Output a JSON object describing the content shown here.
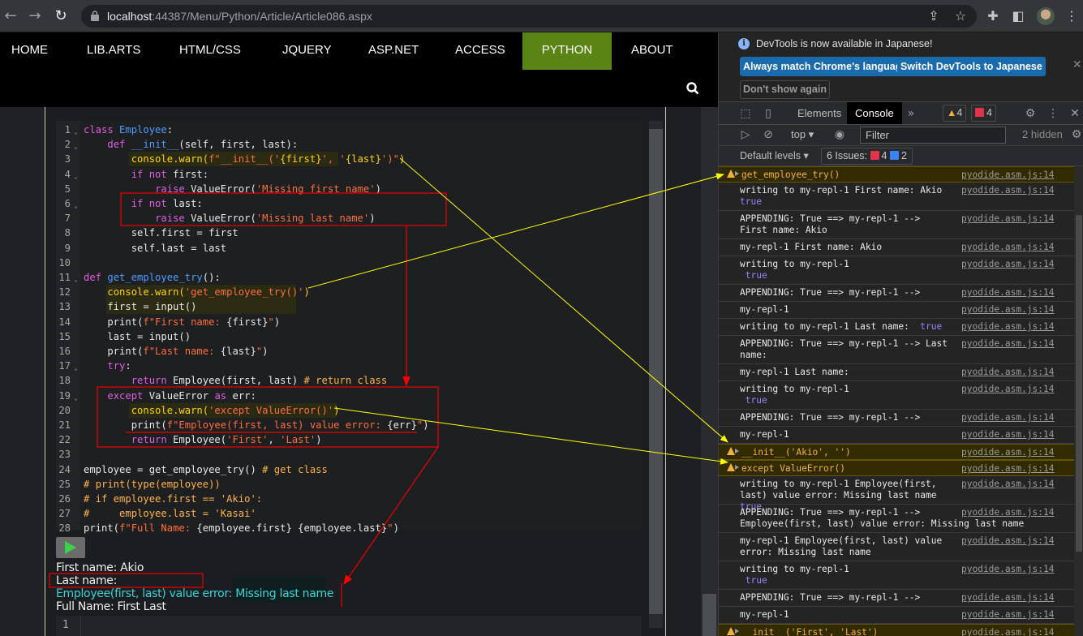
{
  "browser": {
    "url_host": "localhost",
    "url_path": ":44387/Menu/Python/Article/Article086.aspx",
    "icons": [
      "back-icon",
      "forward-icon",
      "reload-icon",
      "lock-icon",
      "share-icon",
      "bookmark-star-icon",
      "extensions-icon",
      "side-panel-icon",
      "profile-avatar",
      "menu-kebab-icon"
    ]
  },
  "site": {
    "nav": [
      {
        "label": "HOME",
        "active": false
      },
      {
        "label": "LIB.ARTS",
        "active": false
      },
      {
        "label": "HTML/CSS",
        "active": false
      },
      {
        "label": "JQUERY",
        "active": false
      },
      {
        "label": "ASP.NET",
        "active": false
      },
      {
        "label": "ACCESS",
        "active": false
      },
      {
        "label": "PYTHON",
        "active": true
      },
      {
        "label": "ABOUT",
        "active": false
      }
    ],
    "accent_color": "#5a8515"
  },
  "editor": {
    "lines": [
      {
        "n": "1",
        "fold": true,
        "code": "<span class='kw'>class</span> <span class='fn'>Employee</span>:"
      },
      {
        "n": "2",
        "fold": true,
        "code": "    <span class='kw'>def</span> <span class='fn'>__init__</span>(self, first, last):"
      },
      {
        "n": "3",
        "fold": false,
        "hl": true,
        "code": "        <span class='cw'>console.warn(</span><span class='str'>f\"__init__('</span><span class='cw'>{first}</span><span class='str'>', '</span><span class='cw'>{last}</span><span class='str'>')\"</span><span class='cw'>)</span>"
      },
      {
        "n": "4",
        "fold": true,
        "code": "        <span class='kw'>if not</span> first:"
      },
      {
        "n": "5",
        "fold": false,
        "code": "            <span class='kw'>raise</span> ValueError(<span class='str'>'Missing first name'</span>)"
      },
      {
        "n": "6",
        "fold": true,
        "code": "        <span class='kw'>if not</span> last:"
      },
      {
        "n": "7",
        "fold": false,
        "code": "            <span class='kw'>raise</span> ValueError(<span class='str'>'Missing last name'</span>)"
      },
      {
        "n": "8",
        "fold": false,
        "code": "        self.first = first"
      },
      {
        "n": "9",
        "fold": false,
        "code": "        self.last = last"
      },
      {
        "n": "10",
        "fold": false,
        "code": ""
      },
      {
        "n": "11",
        "fold": true,
        "code": "<span class='kw'>def</span> <span class='fn'>get_employee_try</span>():"
      },
      {
        "n": "12",
        "fold": false,
        "hl": true,
        "code": "    <span class='cw'>console.warn(</span><span class='str'>'get_employee_try()'</span><span class='cw'>)</span>"
      },
      {
        "n": "13",
        "fold": false,
        "hl": true,
        "code": "    first = input()"
      },
      {
        "n": "14",
        "fold": false,
        "code": "    print(<span class='str'>f\"First name: </span>{first}<span class='str'>\"</span>)"
      },
      {
        "n": "15",
        "fold": false,
        "code": "    last = input()"
      },
      {
        "n": "16",
        "fold": false,
        "code": "    print(<span class='str'>f\"Last name: </span>{last}<span class='str'>\"</span>)"
      },
      {
        "n": "17",
        "fold": true,
        "code": "    <span class='kw'>try</span>:"
      },
      {
        "n": "18",
        "fold": false,
        "code": "        <span class='kw'>return</span> Employee(first, last) <span class='cm'># return class</span>"
      },
      {
        "n": "19",
        "fold": true,
        "code": "    <span class='kw'>except</span> ValueError <span class='kw'>as</span> err:"
      },
      {
        "n": "20",
        "fold": false,
        "hl": true,
        "code": "        <span class='cw'>console.warn(</span><span class='str'>'except ValueError()'</span><span class='cw'>)</span>"
      },
      {
        "n": "21",
        "fold": false,
        "code": "        print(<span class='str'>f\"Employee(first, last) value error: </span>{err}<span class='str'>\"</span>)"
      },
      {
        "n": "22",
        "fold": false,
        "code": "        <span class='kw'>return</span> Employee(<span class='str'>'First'</span>, <span class='str'>'Last'</span>)"
      },
      {
        "n": "23",
        "fold": false,
        "code": ""
      },
      {
        "n": "24",
        "fold": false,
        "code": "employee = get_employee_try() <span class='cm'># get class</span>"
      },
      {
        "n": "25",
        "fold": false,
        "code": "<span class='cm'># print(type(employee))</span>"
      },
      {
        "n": "26",
        "fold": false,
        "code": "<span class='cm'># if employee.first == 'Akio':</span>"
      },
      {
        "n": "27",
        "fold": false,
        "code": "<span class='cm'>#     employee.last = 'Kasai'</span>"
      },
      {
        "n": "28",
        "fold": false,
        "code": "print(<span class='str'>f\"Full Name: </span>{employee.first} {employee.last}<span class='str'>\"</span>)"
      }
    ]
  },
  "output": {
    "lines": [
      {
        "text": "First name: Akio",
        "error": false
      },
      {
        "text": "Last name:",
        "error": false
      },
      {
        "text": "Employee(first, last) value error: Missing last name",
        "error": true
      },
      {
        "text": "Full Name: First Last",
        "error": false
      }
    ],
    "repl_line_number": "1"
  },
  "devtools": {
    "infobar": {
      "message": "DevTools is now available in Japanese!",
      "btn_match": "Always match Chrome's language",
      "btn_switch": "Switch DevTools to Japanese",
      "btn_dont_show": "Don't show again"
    },
    "tabs": {
      "elements": "Elements",
      "console": "Console",
      "more": "»"
    },
    "warnings_count": "4",
    "errors_count": "4",
    "toolbar": {
      "context": "top ▾",
      "filter_placeholder": "Filter",
      "hidden": "2 hidden"
    },
    "levels": {
      "label": "Default levels ▾",
      "issues_label": "6 Issues:",
      "issues_errors": "4",
      "issues_info": "2"
    },
    "messages": [
      {
        "type": "warn",
        "text": "get_employee_try()",
        "src": "pyodide.asm.js:14"
      },
      {
        "type": "log",
        "text": "writing to my-repl-1 First name: Akio",
        "tail": "true",
        "tail_newline": true,
        "src": "pyodide.asm.js:14"
      },
      {
        "type": "log",
        "text": "APPENDING: True ==> my-repl-1 -->\nFirst name: Akio",
        "src": "pyodide.asm.js:14"
      },
      {
        "type": "log",
        "text": "my-repl-1 First name: Akio",
        "src": "pyodide.asm.js:14"
      },
      {
        "type": "log",
        "text": "writing to my-repl-1",
        "tail": " true",
        "tail_newline": true,
        "src": "pyodide.asm.js:14"
      },
      {
        "type": "log",
        "text": "APPENDING: True ==> my-repl-1 -->",
        "src": "pyodide.asm.js:14"
      },
      {
        "type": "log",
        "text": "my-repl-1",
        "src": "pyodide.asm.js:14"
      },
      {
        "type": "log",
        "text": "writing to my-repl-1 Last name:  ",
        "tail": "true",
        "src": "pyodide.asm.js:14"
      },
      {
        "type": "log",
        "text": "APPENDING: True ==> my-repl-1 --> Last\nname:",
        "src": "pyodide.asm.js:14"
      },
      {
        "type": "log",
        "text": "my-repl-1 Last name:",
        "src": "pyodide.asm.js:14"
      },
      {
        "type": "log",
        "text": "writing to my-repl-1",
        "tail": " true",
        "tail_newline": true,
        "src": "pyodide.asm.js:14"
      },
      {
        "type": "log",
        "text": "APPENDING: True ==> my-repl-1 -->",
        "src": "pyodide.asm.js:14"
      },
      {
        "type": "log",
        "text": "my-repl-1",
        "src": "pyodide.asm.js:14"
      },
      {
        "type": "warn",
        "text": "__init__('Akio', '')",
        "src": "pyodide.asm.js:14"
      },
      {
        "type": "warn",
        "text": "except ValueError()",
        "src": "pyodide.asm.js:14"
      },
      {
        "type": "log",
        "text": "writing to my-repl-1 Employee(first,\nlast) value error: Missing last name ",
        "tail": "true",
        "src": "pyodide.asm.js:14"
      },
      {
        "type": "log",
        "text": "APPENDING: True ==> my-repl-1 -->\nEmployee(first, last) value error: Missing last name",
        "src": "pyodide.asm.js:14",
        "wide": true
      },
      {
        "type": "log",
        "text": "my-repl-1 Employee(first, last) value\nerror: Missing last name",
        "src": "pyodide.asm.js:14"
      },
      {
        "type": "log",
        "text": "writing to my-repl-1",
        "tail": " true",
        "tail_newline": true,
        "src": "pyodide.asm.js:14"
      },
      {
        "type": "log",
        "text": "APPENDING: True ==> my-repl-1 -->",
        "src": "pyodide.asm.js:14"
      },
      {
        "type": "log",
        "text": "my-repl-1",
        "src": "pyodide.asm.js:14"
      },
      {
        "type": "warn",
        "text": "__init__('First', 'Last')",
        "src": "pyodide.asm.js:14"
      }
    ]
  }
}
